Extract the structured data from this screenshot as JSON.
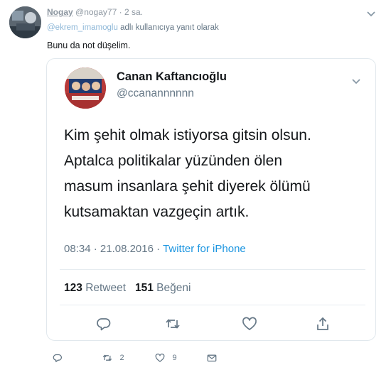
{
  "outer_tweet": {
    "author_name": "Nogay",
    "author_handle": "@nogay77",
    "separator": "·",
    "time": "2 sa.",
    "reply_mention": "@ekrem_imamoglu",
    "reply_suffix": " adlı kullanıcıya yanıt olarak",
    "text": "Bunu da not düşelim.",
    "actions": {
      "reply_icon": "comment-icon",
      "retweet_icon": "retweet-icon",
      "retweet_count": "2",
      "like_icon": "heart-icon",
      "like_count": "9",
      "message_icon": "envelope-icon"
    }
  },
  "embedded_tweet": {
    "author_name": "Canan Kaftancıoğlu",
    "author_handle": "@ccanannnnnn",
    "text_lines": [
      "Kim şehit olmak istiyorsa gitsin olsun.",
      "Aptalca politikalar yüzünden ölen",
      "masum insanlara şehit diyerek ölümü",
      "kutsamaktan vazgeçin artık."
    ],
    "time": "08:34",
    "date_separator": " · ",
    "date": "21.08.2016",
    "source_separator": " · ",
    "source": "Twitter for iPhone",
    "retweet_count": "123",
    "retweet_label": "Retweet",
    "like_count": "151",
    "like_label": "Beğeni",
    "actions": {
      "reply_icon": "comment-icon",
      "retweet_icon": "retweet-icon",
      "like_icon": "heart-icon",
      "share_icon": "share-icon"
    }
  },
  "colors": {
    "link_blue": "#1b95e0",
    "muted_gray": "#657786",
    "border": "#e1e8ed"
  }
}
